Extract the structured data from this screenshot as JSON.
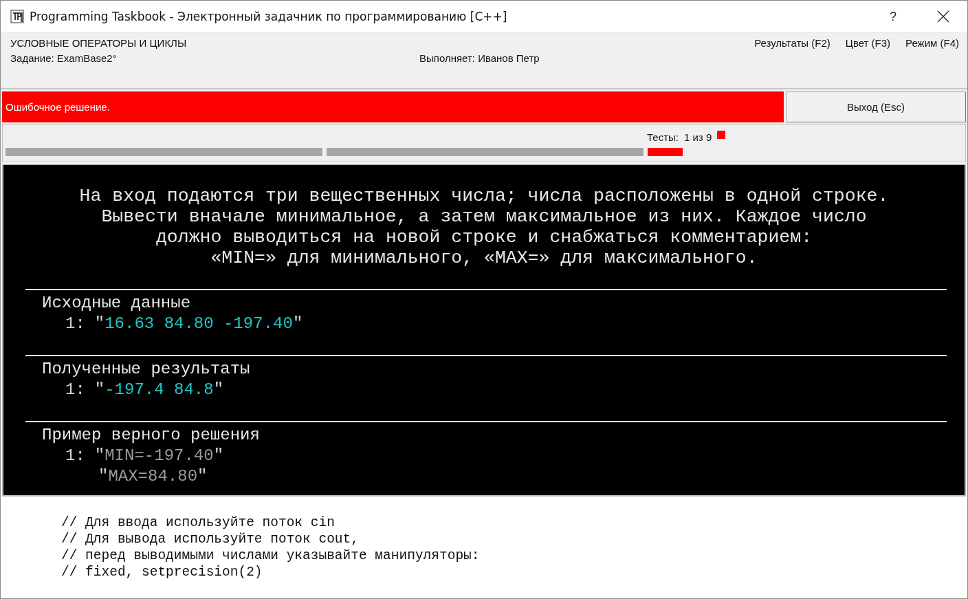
{
  "window": {
    "title": "Programming Taskbook - Электронный задачник по программированию [C++]",
    "help": "?"
  },
  "header": {
    "group": "УСЛОВНЫЕ ОПЕРАТОРЫ И ЦИКЛЫ",
    "task": "Задание: ExamBase2°",
    "student": "Выполняет: Иванов Петр",
    "menu": [
      "Результаты (F2)",
      "Цвет (F3)",
      "Режим (F4)"
    ]
  },
  "status": {
    "message": "Ошибочное решение.",
    "error": true,
    "exit_button": "Выход (Esc)"
  },
  "tests": {
    "label": "Тесты:",
    "count": "1 из 9",
    "indicator": {
      "color": "#ff0000"
    },
    "segments": [
      {
        "kind": "wide",
        "color": "#a6a6a6"
      },
      {
        "kind": "wide",
        "color": "#a6a6a6"
      },
      {
        "kind": "narrow",
        "color": "#ff0000"
      }
    ]
  },
  "task_text": [
    "На вход подаются три вещественных числа; числа расположены в одной строке.",
    "Вывести вначале минимальное, а затем максимальное из них. Каждое число",
    "должно выводиться на новой строке и снабжаться комментарием:",
    "«MIN=» для минимального, «MAX=» для максимального."
  ],
  "sections": [
    {
      "title": "Исходные данные",
      "kind": "data",
      "lines": [
        {
          "number": "1:",
          "open": "\"",
          "value": "16.63 84.80 -197.40",
          "close": "\""
        }
      ]
    },
    {
      "title": "Полученные результаты",
      "kind": "data",
      "lines": [
        {
          "number": "1:",
          "open": "\"",
          "value": "-197.4 84.8",
          "close": "\""
        }
      ]
    },
    {
      "title": "Пример верного решения",
      "kind": "sample",
      "lines": [
        {
          "number": "1:",
          "open": "\"",
          "value": "MIN=-197.40",
          "close": "\""
        },
        {
          "open": "\"",
          "value": "MAX=84.80",
          "close": "\""
        }
      ]
    }
  ],
  "comments": [
    "// Для ввода используйте поток cin",
    "// Для вывода используйте поток cout,",
    "// перед выводимыми числами указывайте манипуляторы:",
    "// fixed, setprecision(2)"
  ]
}
